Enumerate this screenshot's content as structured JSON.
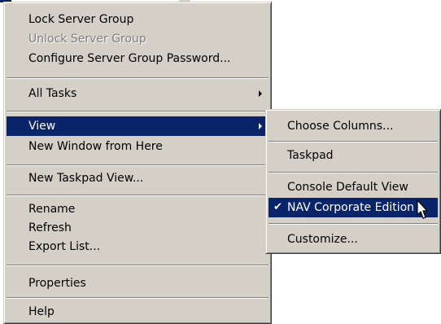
{
  "main_menu": {
    "lock_server_group": "Lock Server Group",
    "unlock_server_group": "Unlock Server Group",
    "configure_password": "Configure Server Group Password...",
    "all_tasks": "All Tasks",
    "view": "View",
    "new_window": "New Window from Here",
    "new_taskpad_view": "New Taskpad View...",
    "rename": "Rename",
    "refresh": "Refresh",
    "export_list": "Export List...",
    "properties": "Properties",
    "help": "Help"
  },
  "view_submenu": {
    "choose_columns": "Choose Columns...",
    "taskpad": "Taskpad",
    "console_default_view": "Console Default View",
    "nav_corporate_edition": "NAV Corporate Edition",
    "customize": "Customize...",
    "checked_item_mark": "✔"
  },
  "colors": {
    "menu_face": "#d4d0c8",
    "highlight": "#0a246a",
    "highlight_text": "#ffffff",
    "disabled_text": "#808080"
  }
}
